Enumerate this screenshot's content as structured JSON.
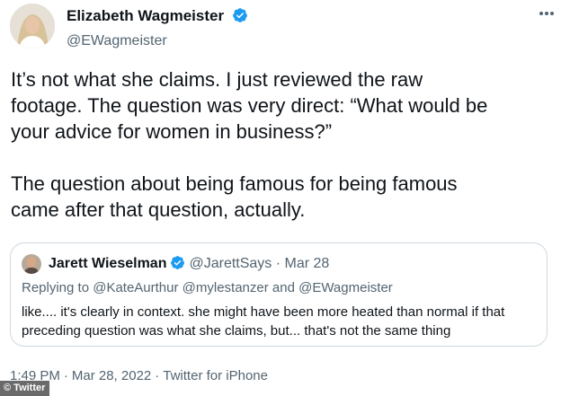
{
  "author": {
    "display_name": "Elizabeth Wagmeister",
    "handle": "@EWagmeister",
    "verified": true
  },
  "tweet": {
    "text": "It’s not what she claims. I just reviewed the raw\nfootage. The question was very direct: “What would be\nyour advice for women in business?”\n\nThe question about being famous for being famous\ncame after that question, actually."
  },
  "quoted_tweet": {
    "display_name": "Jarett Wieselman",
    "handle": "@JarettSays",
    "date": "Mar 28",
    "separator": "·",
    "reply_label": "Replying to @KateAurthur @mylestanzer and @EWagmeister",
    "text": "like.... it's clearly in context. she might have been more heated than normal if that preceding question was what she claims, but... that's not the same thing"
  },
  "footer": {
    "time": "1:49 PM",
    "date": "Mar 28, 2022",
    "source": "Twitter for iPhone",
    "separator": "·"
  },
  "watermark": "© Twitter",
  "icons": {
    "verified": "verified-badge-icon",
    "more": "more-options-icon"
  },
  "colors": {
    "text_primary": "#0f1419",
    "text_secondary": "#536471",
    "verified_blue": "#1d9bf0",
    "border": "#cfd9de"
  }
}
